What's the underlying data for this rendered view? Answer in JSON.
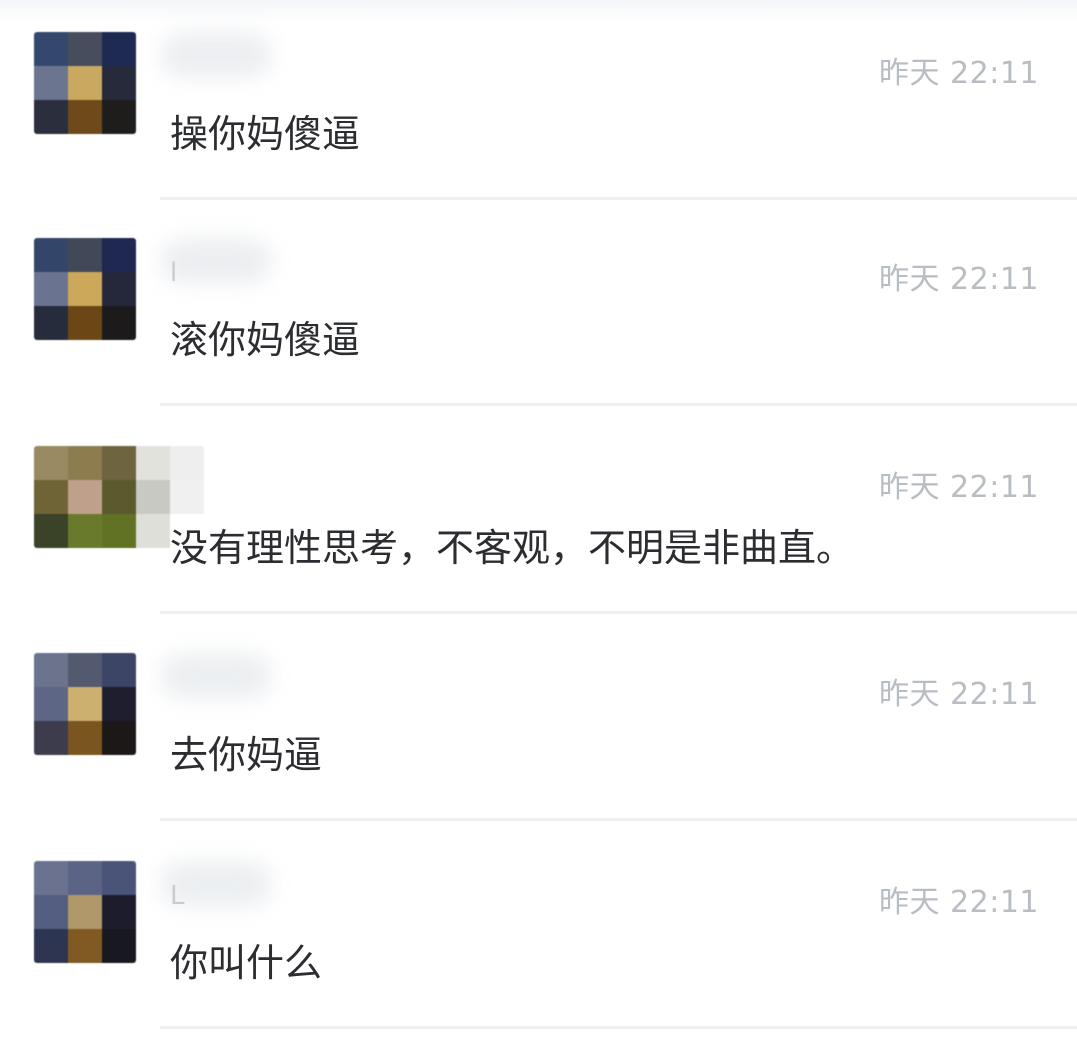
{
  "comments": [
    {
      "name_hint": "",
      "time": "昨天 22:11",
      "text": "操你妈傻逼",
      "avatar_colors": [
        "#34486e",
        "#474d5c",
        "#1e2a52",
        "#6b7590",
        "#c9a860",
        "#262a3a",
        "#2b2f3d",
        "#6e4a1a",
        "#1f1c1c"
      ]
    },
    {
      "name_hint": "l",
      "time": "昨天 22:11",
      "text": "滚你妈傻逼",
      "avatar_colors": [
        "#33466a",
        "#414857",
        "#1e2850",
        "#6a7390",
        "#cca85a",
        "#24283a",
        "#262c3c",
        "#6b4715",
        "#1d1a1c"
      ]
    },
    {
      "name_hint": "",
      "time": "昨天 22:11",
      "text": "没有理性思考，不客观，不明是非曲直。",
      "avatar_colors": [
        "#9a8a62",
        "#8c7c4e",
        "#6f6440",
        "#e2e2dc",
        "#eeeeee",
        "#6f6436",
        "#bfa08a",
        "#5a5a2c",
        "#c9c9c4",
        "#f0f0f0",
        "#3a4228",
        "#6a7a2c",
        "#627224",
        "#dedfd8",
        "#ffffff"
      ]
    },
    {
      "name_hint": "",
      "time": "昨天 22:11",
      "text": "去你妈逼",
      "avatar_colors": [
        "#6c738c",
        "#535a70",
        "#3c4565",
        "#5d6684",
        "#ccb070",
        "#1e1e2e",
        "#3c3c4c",
        "#7a5520",
        "#1c1818"
      ]
    },
    {
      "name_hint": "L",
      "time": "昨天 22:11",
      "text": "你叫什么",
      "avatar_colors": [
        "#6a7290",
        "#5c6486",
        "#4a5478",
        "#545e80",
        "#b0986a",
        "#1c1c2c",
        "#2e3550",
        "#805a22",
        "#181820"
      ]
    }
  ]
}
